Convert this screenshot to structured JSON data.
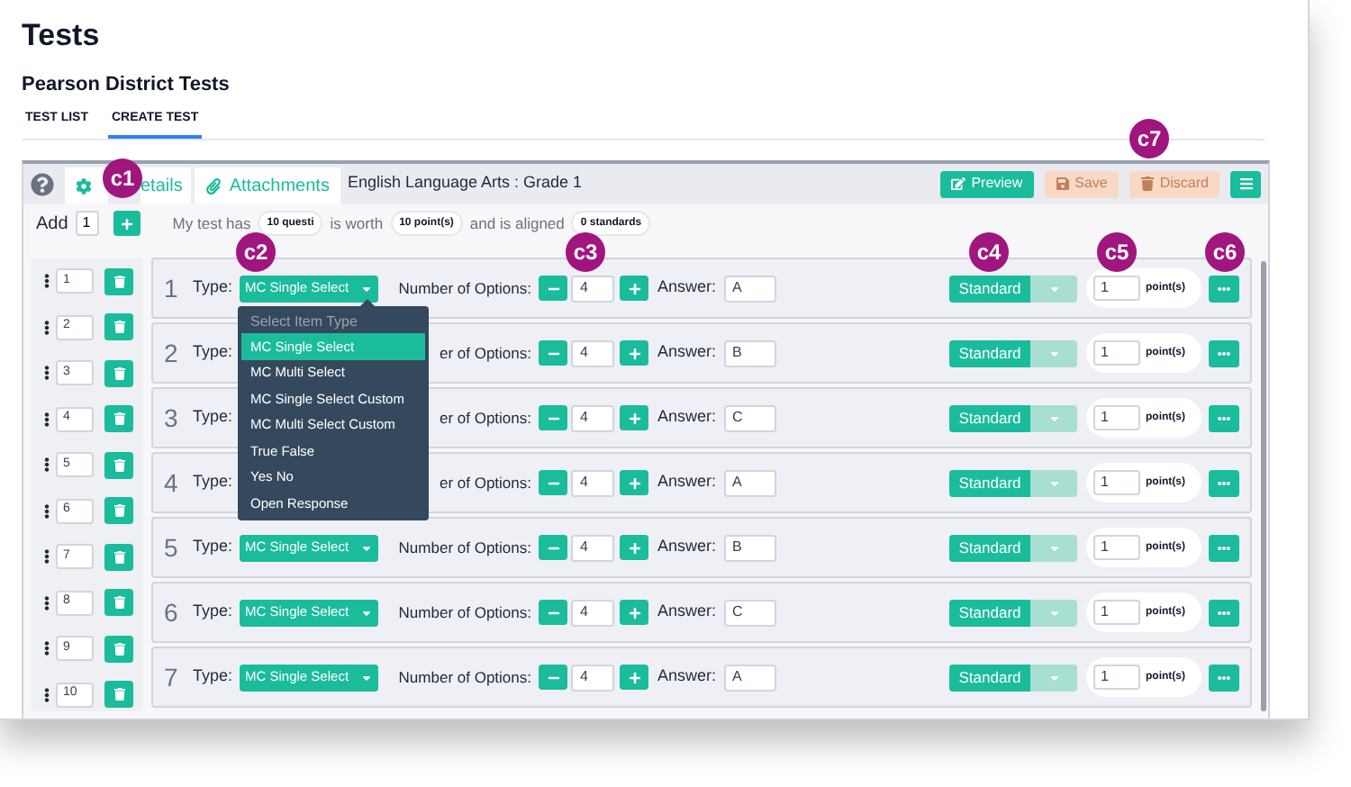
{
  "page": {
    "title": "Tests",
    "subtitle": "Pearson District Tests"
  },
  "nav_tabs": [
    {
      "label": "TEST LIST",
      "selected": false
    },
    {
      "label": "CREATE TEST",
      "selected": true
    }
  ],
  "editor": {
    "tabs": [
      {
        "label": "etails",
        "kind": "details"
      },
      {
        "label": "Attachments",
        "kind": "attachments"
      }
    ],
    "subject": "English Language Arts : Grade 1",
    "actions": [
      {
        "label": "Preview",
        "kind": "preview",
        "disabled": false
      },
      {
        "label": "Save",
        "kind": "save",
        "disabled": true
      },
      {
        "label": "Discard",
        "kind": "discard",
        "disabled": true
      }
    ],
    "add": {
      "label": "Add",
      "value": "1"
    },
    "summary": [
      {
        "kind": "text",
        "text": "My test has"
      },
      {
        "kind": "pill",
        "text": "10 questi"
      },
      {
        "kind": "text",
        "text": "is worth"
      },
      {
        "kind": "pill",
        "text": "10 point(s)"
      },
      {
        "kind": "text",
        "text": "and is aligned"
      },
      {
        "kind": "pill",
        "text": "0 standards"
      }
    ],
    "order": [
      "1",
      "2",
      "3",
      "4",
      "5",
      "6",
      "7",
      "8",
      "9",
      "10"
    ],
    "questions": [
      {
        "number": "1",
        "type_label": "Type:",
        "type": "MC Single Select",
        "options_label": "Number of Options:",
        "options": "4",
        "answer_label": "Answer:",
        "answer": "A",
        "standard": "Standard",
        "points": "1",
        "points_label": "point(s)"
      },
      {
        "number": "2",
        "type_label": "Type:",
        "options_label": "er of Options:",
        "options": "4",
        "answer_label": "Answer:",
        "answer": "B",
        "standard": "Standard",
        "points": "1",
        "points_label": "point(s)"
      },
      {
        "number": "3",
        "type_label": "Type:",
        "options_label": "er of Options:",
        "options": "4",
        "answer_label": "Answer:",
        "answer": "C",
        "standard": "Standard",
        "points": "1",
        "points_label": "point(s)"
      },
      {
        "number": "4",
        "type_label": "Type:",
        "options_label": "er of Options:",
        "options": "4",
        "answer_label": "Answer:",
        "answer": "A",
        "standard": "Standard",
        "points": "1",
        "points_label": "point(s)"
      },
      {
        "number": "5",
        "type_label": "Type:",
        "type": "MC Single Select",
        "options_label": "Number of Options:",
        "options": "4",
        "answer_label": "Answer:",
        "answer": "B",
        "standard": "Standard",
        "points": "1",
        "points_label": "point(s)"
      },
      {
        "number": "6",
        "type_label": "Type:",
        "type": "MC Single Select",
        "options_label": "Number of Options:",
        "options": "4",
        "answer_label": "Answer:",
        "answer": "C",
        "standard": "Standard",
        "points": "1",
        "points_label": "point(s)"
      },
      {
        "number": "7",
        "type_label": "Type:",
        "type": "MC Single Select",
        "options_label": "Number of Options:",
        "options": "4",
        "answer_label": "Answer:",
        "answer": "A",
        "standard": "Standard",
        "points": "1",
        "points_label": "point(s)"
      }
    ],
    "type_menu": {
      "header": "Select Item Type",
      "items": [
        {
          "label": "MC Single Select",
          "selected": true
        },
        {
          "label": "MC Multi Select",
          "selected": false
        },
        {
          "label": "MC Single Select Custom",
          "selected": false
        },
        {
          "label": "MC Multi Select Custom",
          "selected": false
        },
        {
          "label": "True False",
          "selected": false
        },
        {
          "label": "Yes No",
          "selected": false
        },
        {
          "label": "Open Response",
          "selected": false
        }
      ]
    }
  },
  "callouts": [
    "c1",
    "c2",
    "c3",
    "c4",
    "c5",
    "c6",
    "c7"
  ]
}
